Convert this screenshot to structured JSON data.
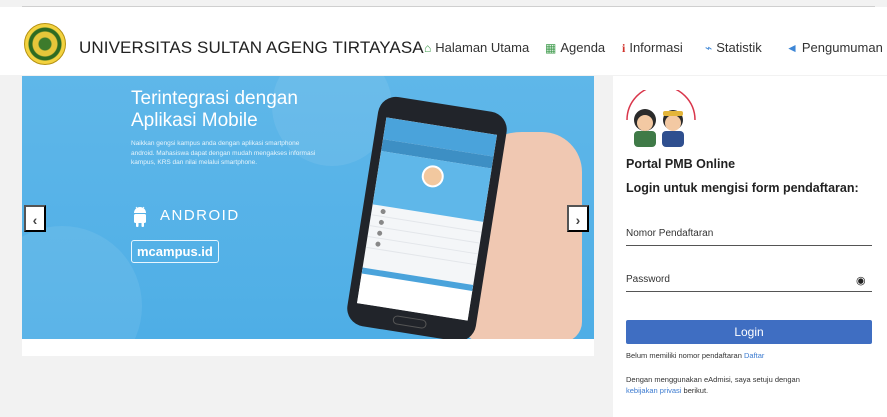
{
  "header": {
    "university_name": "UNIVERSITAS SULTAN AGENG TIRTAYASA",
    "nav": [
      {
        "label": "Halaman Utama",
        "icon": "home-icon"
      },
      {
        "label": "Agenda",
        "icon": "calendar-icon"
      },
      {
        "label": "Informasi",
        "icon": "info-icon"
      },
      {
        "label": "Statistik",
        "icon": "chart-icon"
      },
      {
        "label": "Pengumuman",
        "icon": "megaphone-icon"
      }
    ]
  },
  "carousel": {
    "title_line1": "Terintegrasi dengan",
    "title_line2": "Aplikasi Mobile",
    "description": "Naikkan gengsi kampus anda dengan aplikasi smartphone android. Mahasiswa dapat dengan mudah mengakses informasi kampus, KRS dan nilai melalui smartphone.",
    "platform": "ANDROID",
    "url_badge": "mcampus.id",
    "prev_label": "‹",
    "next_label": "›"
  },
  "login": {
    "portal_title": "Portal PMB Online",
    "subtitle": "Login untuk mengisi form pendaftaran:",
    "registration_placeholder": "Nomor Pendaftaran",
    "password_placeholder": "Password",
    "button_label": "Login",
    "no_account_text": "Belum memiliki nomor pendaftaran",
    "register_link": "Daftar",
    "agreement_text": "Dengan menggunakan eAdmisi, saya setuju dengan",
    "privacy_link": "kebijakan privasi",
    "agreement_suffix": "berikut."
  },
  "colors": {
    "accent_blue": "#3f6ec2",
    "slide_blue": "#5fb7e9",
    "link_blue": "#3c7bd0"
  }
}
